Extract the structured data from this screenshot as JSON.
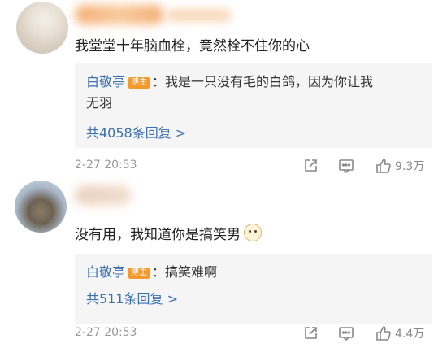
{
  "comments": [
    {
      "text": "我堂堂十年脑血栓，竟然栓不住你的心",
      "reply": {
        "author": "白敬亭",
        "badge": "博主",
        "text": "：我是一只没有毛的白鸽，因为你让我",
        "text2": "无羽",
        "more": "共4058条回复 >"
      },
      "timestamp": "2-27 20:53",
      "likes": "9.3万",
      "icons": [
        "share-icon",
        "comment-icon",
        "like-icon"
      ]
    },
    {
      "text": "没有用，我知道你是搞笑男",
      "reply": {
        "author": "白敬亭",
        "badge": "博主",
        "text": "：搞笑难啊",
        "more": "共511条回复 >"
      },
      "timestamp": "2-27 20:53",
      "likes": "4.4万",
      "icons": [
        "share-icon",
        "comment-icon",
        "like-icon"
      ]
    }
  ],
  "colors": {
    "link": "#3a6fb0",
    "badge": "#f49a2c",
    "reply_bg": "#f5f5f5",
    "meta": "#999999"
  }
}
